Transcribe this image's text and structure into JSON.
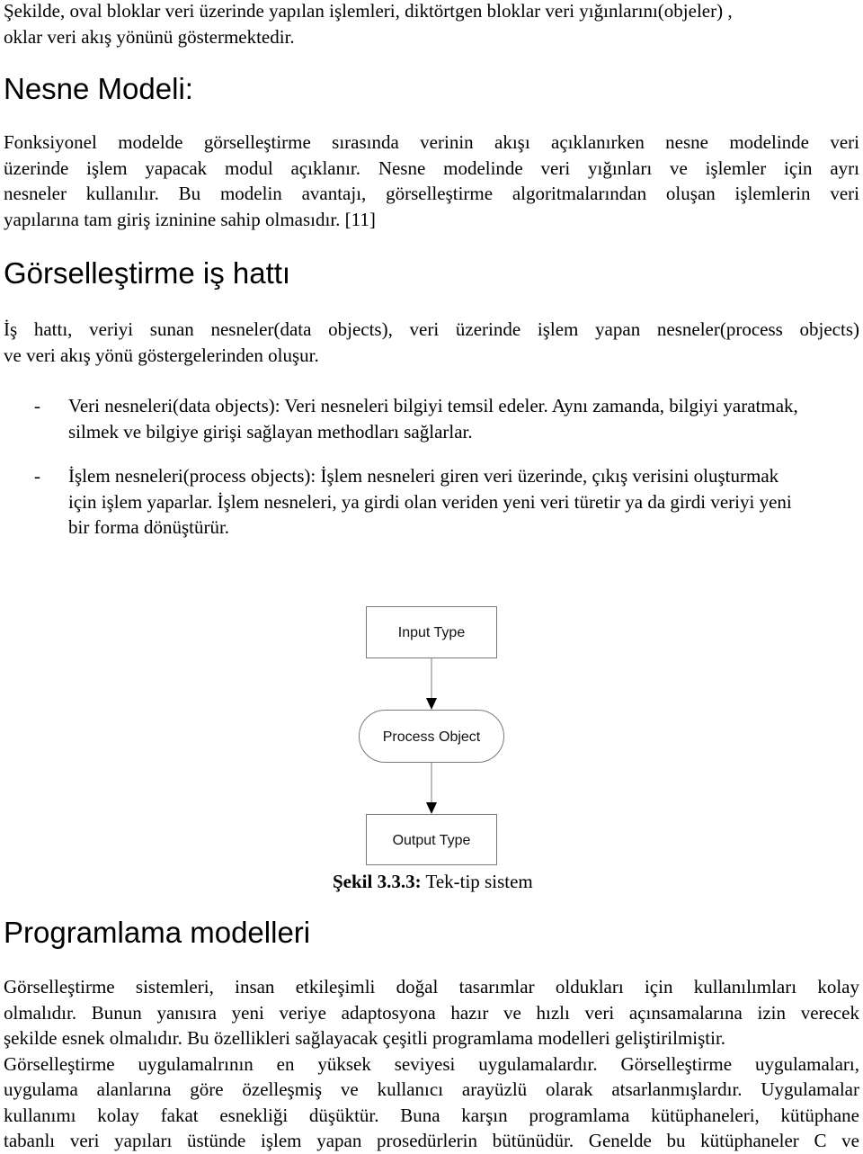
{
  "intro": {
    "lines": [
      "Şekilde, oval bloklar veri üzerinde yapılan işlemleri, diktörtgen bloklar veri yığınlarını(objeler) ,",
      "oklar veri akış yönünü göstermektedir."
    ]
  },
  "section_object_model": {
    "heading": "Nesne Modeli:",
    "paragraph_lines": [
      "Fonksiyonel modelde görselleştirme sırasında verinin akışı açıklanırken nesne modelinde veri",
      "üzerinde işlem yapacak modul açıklanır. Nesne modelinde veri yığınları ve işlemler için ayrı",
      "nesneler kullanılır. Bu modelin avantajı, görselleştirme algoritmalarından oluşan işlemlerin veri",
      "yapılarına tam giriş izninine sahip olmasıdır. [11]"
    ]
  },
  "section_pipeline": {
    "heading": "Görselleştirme iş hattı",
    "paragraph_lines": [
      "İş hattı, veriyi sunan nesneler(data objects), veri üzerinde işlem yapan nesneler(process objects)",
      "ve veri akış yönü göstergelerinden oluşur."
    ],
    "list": [
      {
        "bullet": "-",
        "lines": [
          "Veri nesneleri(data objects): Veri nesneleri bilgiyi temsil edeler. Aynı zamanda, bilgiyi yaratmak,",
          "silmek ve bilgiye girişi sağlayan methodları sağlarlar."
        ]
      },
      {
        "bullet": "-",
        "lines": [
          "İşlem nesneleri(process objects): İşlem nesneleri giren veri üzerinde, çıkış verisini oluşturmak",
          "için işlem yaparlar. İşlem nesneleri, ya girdi olan veriden yeni veri türetir ya da girdi veriyi yeni",
          "bir forma dönüştürür."
        ]
      }
    ]
  },
  "figure": {
    "nodes": [
      {
        "id": "input",
        "shape": "rectangle",
        "label": "Input Type"
      },
      {
        "id": "process",
        "shape": "oval",
        "label": "Process Object"
      },
      {
        "id": "output",
        "shape": "rectangle",
        "label": "Output Type"
      }
    ],
    "edges": [
      {
        "from": "input",
        "to": "process"
      },
      {
        "from": "process",
        "to": "output"
      }
    ],
    "caption_label": "Şekil 3.3.3:",
    "caption_text": " Tek-tip sistem",
    "stroke_color": "#7a7a7a",
    "arrow_color": "#000000"
  },
  "section_programming": {
    "heading": "Programlama modelleri",
    "paragraph_lines": [
      "Görselleştirme sistemleri, insan etkileşimli doğal tasarımlar oldukları için kullanılımları kolay",
      "olmalıdır. Bunun yanısıra yeni veriye adaptosyona hazır ve hızlı veri açınsamalarına izin verecek",
      "şekilde esnek olmalıdır. Bu özellikleri sağlayacak çeşitli programlama modelleri geliştirilmiştir.",
      "Görselleştirme uygulamalrının en yüksek seviyesi uygulamalardır. Görselleştirme uygulamaları,",
      "uygulama alanlarına göre özelleşmiş ve kullanıcı arayüzlü olarak atsarlanmışlardır. Uygulamalar",
      "kullanımı kolay fakat esnekliği düşüktür. Buna karşın programlama kütüphaneleri, kütüphane",
      "tabanlı veri yapıları üstünde işlem yapan prosedürlerin bütünüdür. Genelde bu kütüphaneler C ve"
    ]
  }
}
